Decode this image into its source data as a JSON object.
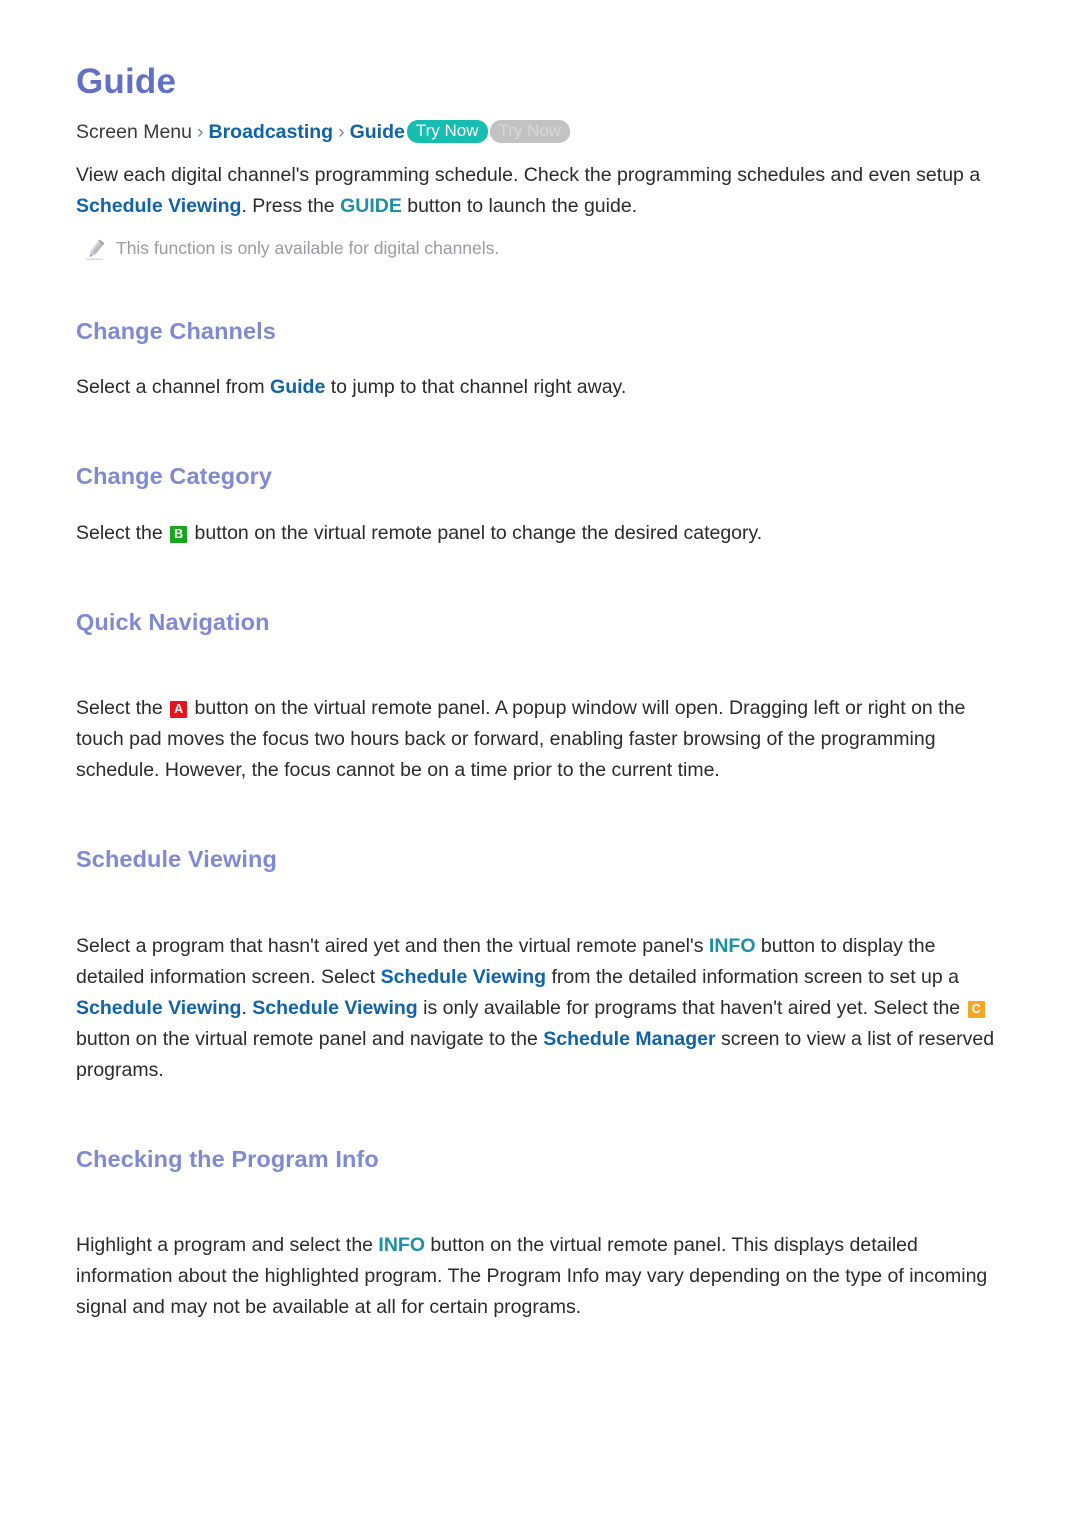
{
  "document": {
    "title": "Guide"
  },
  "breadcrumb": {
    "root_label": "Screen Menu",
    "separator": "›",
    "item1_label": "Broadcasting",
    "item2_label": "Guide",
    "badge_active_label": "Try Now",
    "badge_inactive_label": "Try Now"
  },
  "intro": {
    "line1_a": "View each digital channel's programming schedule. Check the programming schedules and even setup",
    "line2_a": "a ",
    "link_schedule_viewing": "Schedule Viewing",
    "line2_b": ". Press the ",
    "link_guide_button": "GUIDE",
    "line2_c": " button to launch the guide.",
    "note_icon": "pencil-icon",
    "note_text": "This function is only available for digital channels."
  },
  "sections": [
    {
      "heading": "Change Channels",
      "body_a": "Select a channel from ",
      "link1": "Guide",
      "body_b": " to jump to that channel right away."
    },
    {
      "heading": "Change Category",
      "body_a": "Select the ",
      "key_button": "B",
      "body_b": " button on the virtual remote panel to change the desired category."
    },
    {
      "heading": "Quick Navigation",
      "body_a": "Select the ",
      "key_button": "A",
      "body_b": " button on the virtual remote panel. A popup window will open. Dragging left or right on the touch pad moves the focus two hours back or forward, enabling faster browsing of the programming schedule. However, the focus cannot be on a time prior to the current time."
    },
    {
      "heading": "Schedule Viewing",
      "body_a": "Select a program that hasn't aired yet and then the virtual remote panel's ",
      "link_info": "INFO",
      "body_b": " button to display the detailed information screen. Select ",
      "link_sv1": "Schedule Viewing",
      "body_c": " from the detailed information screen to set up a ",
      "link_sv2": "Schedule Viewing",
      "body_d": ". ",
      "link_sv3": "Schedule Viewing",
      "body_e": " is only available for programs that haven't aired yet. Select the ",
      "key_button": "C",
      "body_f": " button on the virtual remote panel and navigate to the ",
      "link_schedule_manager": "Schedule Manager",
      "body_g": " screen to view a list of reserved programs."
    },
    {
      "heading": "Checking the Program Info",
      "body_a": "Highlight a program and select the ",
      "link_info": "INFO",
      "body_b": " button on the virtual remote panel. This displays detailed information about the highlighted program. The Program Info may vary depending on the type of incoming signal and may not be available at all for certain programs."
    }
  ],
  "colors": {
    "title": "#6270c8",
    "section_heading": "#8089d4",
    "link_blue": "#0f63ad",
    "link_teal": "#1d8fa6",
    "badge_active_bg": "#17bdb0",
    "badge_inactive_bg": "#c2c2c2",
    "key_a": "#e8141c",
    "key_b": "#18a61e",
    "key_c": "#f5a623",
    "note_text": "#9a9aa5",
    "body_text": "#2b2b2b"
  }
}
